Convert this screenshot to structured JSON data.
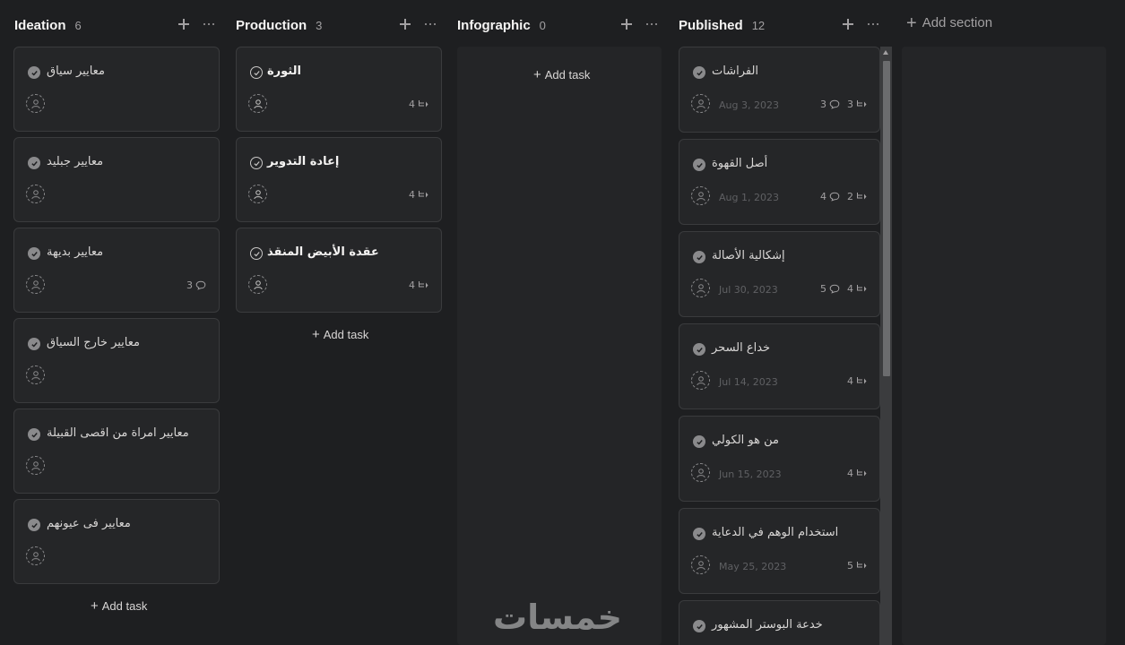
{
  "columns": [
    {
      "title": "Ideation",
      "count": "6",
      "add_task_label": "Add task",
      "cards": [
        {
          "title": "معايير سياق"
        },
        {
          "title": "معايير جبليد"
        },
        {
          "title": "معايير بديهة",
          "comments": "3"
        },
        {
          "title": "معايير خارج السياق"
        },
        {
          "title": "معايير امراة من اقصى القبيلة"
        },
        {
          "title": "معايير فى عيونهم"
        }
      ]
    },
    {
      "title": "Production",
      "count": "3",
      "add_task_label": "Add task",
      "cards": [
        {
          "title": "الثورة",
          "subtasks": "4"
        },
        {
          "title": "إعادة التدوير",
          "subtasks": "4"
        },
        {
          "title": "عقدة الأبيض المنقذ",
          "subtasks": "4"
        }
      ]
    },
    {
      "title": "Infographic",
      "count": "0",
      "add_task_label": "Add task",
      "cards": []
    },
    {
      "title": "Published",
      "count": "12",
      "cards": [
        {
          "title": "الفراشات",
          "date": "Aug 3, 2023",
          "comments": "3",
          "subtasks": "3"
        },
        {
          "title": "أصل القهوة",
          "date": "Aug 1, 2023",
          "comments": "4",
          "subtasks": "2"
        },
        {
          "title": "إشكالية الأصالة",
          "date": "Jul 30, 2023",
          "comments": "5",
          "subtasks": "4"
        },
        {
          "title": "خداع السحر",
          "date": "Jul 14, 2023",
          "subtasks": "4"
        },
        {
          "title": "من هو الكولي",
          "date": "Jun 15, 2023",
          "subtasks": "4"
        },
        {
          "title": "استخدام الوهم في الدعاية",
          "date": "May 25, 2023",
          "subtasks": "5"
        },
        {
          "title": "خدعة البوستر المشهور"
        }
      ]
    }
  ],
  "add_section_label": "Add section",
  "watermark": "خمسات",
  "icons": {
    "column_add": "plus-icon",
    "column_more": "more-horizontal-icon",
    "complete": "check-circle-icon",
    "assignee": "user-placeholder-icon",
    "comment": "comment-icon",
    "subtask": "subtask-icon"
  },
  "colors": {
    "background": "#1e1f21",
    "card": "#252628",
    "card_border": "#3a3b3d",
    "text_primary": "#f5f4f3",
    "text_secondary": "#a2a0a2"
  }
}
